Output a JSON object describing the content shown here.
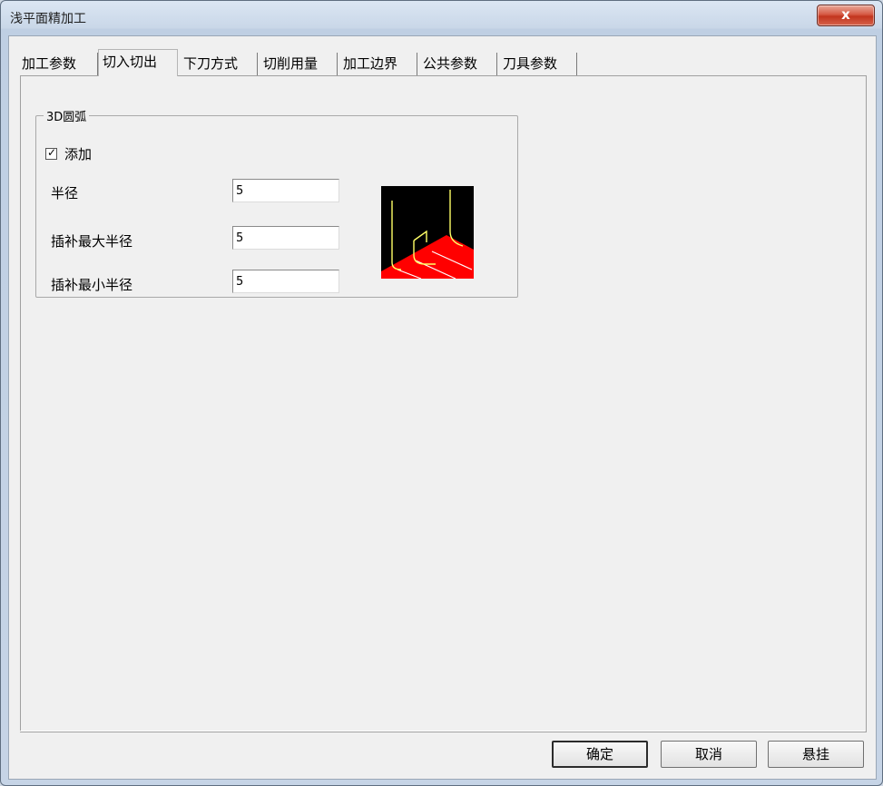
{
  "window": {
    "title": "浅平面精加工",
    "close_glyph": "x"
  },
  "tabs": [
    {
      "label": "加工参数"
    },
    {
      "label": "切入切出",
      "active": true
    },
    {
      "label": "下刀方式"
    },
    {
      "label": "切削用量"
    },
    {
      "label": "加工边界"
    },
    {
      "label": "公共参数"
    },
    {
      "label": "刀具参数"
    }
  ],
  "arc_group": {
    "legend": "3D圆弧",
    "add_checkbox": {
      "label": "添加",
      "checked": true,
      "check_glyph": "✓"
    },
    "fields": [
      {
        "label": "半径",
        "value": "5"
      },
      {
        "label": "插补最大半径",
        "value": "5"
      },
      {
        "label": "插补最小半径",
        "value": "5"
      }
    ]
  },
  "buttons": {
    "ok": "确定",
    "cancel": "取消",
    "suspend": "悬挂"
  },
  "colors": {
    "preview_bg": "#000000",
    "preview_surface": "#ff0000",
    "preview_path": "#ffff66"
  }
}
